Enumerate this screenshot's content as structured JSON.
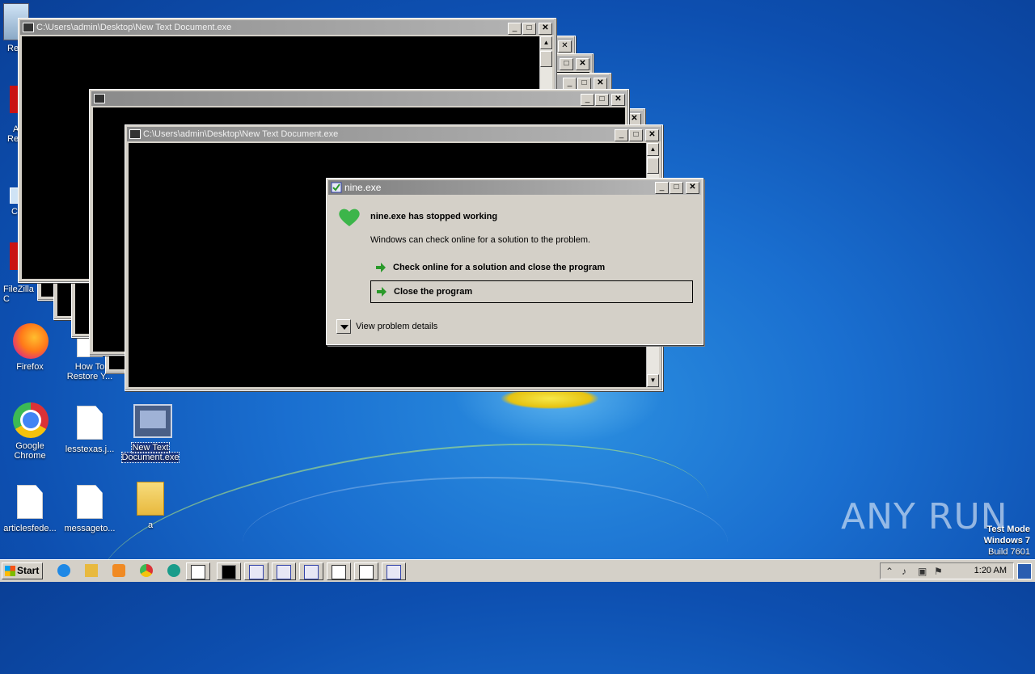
{
  "desktop": {
    "icons": [
      {
        "name": "Firefox",
        "label": "Firefox"
      },
      {
        "name": "How To Restore",
        "label1": "How To",
        "label2": "Restore Y..."
      },
      {
        "name": "Google Chrome",
        "label1": "Google",
        "label2": "Chrome"
      },
      {
        "name": "lesstexas",
        "label": "lesstexas.j..."
      },
      {
        "name": "New Text Document",
        "label1": "New Text",
        "label2": "Document.exe"
      },
      {
        "name": "articlesfede",
        "label": "articlesfede..."
      },
      {
        "name": "messageto",
        "label": "messageto..."
      },
      {
        "name": "a",
        "label": "a"
      }
    ],
    "partial_labels": [
      "Re",
      "A",
      "Re",
      "C",
      "FileZilla C"
    ]
  },
  "console_windows": {
    "title_a": "C:\\Users\\admin\\Desktop\\New Text Document.exe",
    "title_b": "",
    "title_c": "C:\\Users\\admin\\Desktop\\New Text Document.exe"
  },
  "dialog": {
    "title": "nine.exe",
    "heading": "nine.exe has stopped working",
    "message": "Windows can check online for a solution to the problem.",
    "option_check": "Check online for a solution and close the program",
    "option_close": "Close the program",
    "details": "View problem details"
  },
  "watermark": {
    "brand": "ANY RUN",
    "mode": "Test Mode",
    "os": "Windows 7",
    "build": "Build 7601"
  },
  "taskbar": {
    "start_label": "Start",
    "clock": "1:20 AM"
  },
  "colors": {
    "desktop_blue": "#1a6fd0",
    "console_bg": "#000000",
    "dialog_bg": "#d4d0c8",
    "ok_green": "#3cb54a"
  }
}
